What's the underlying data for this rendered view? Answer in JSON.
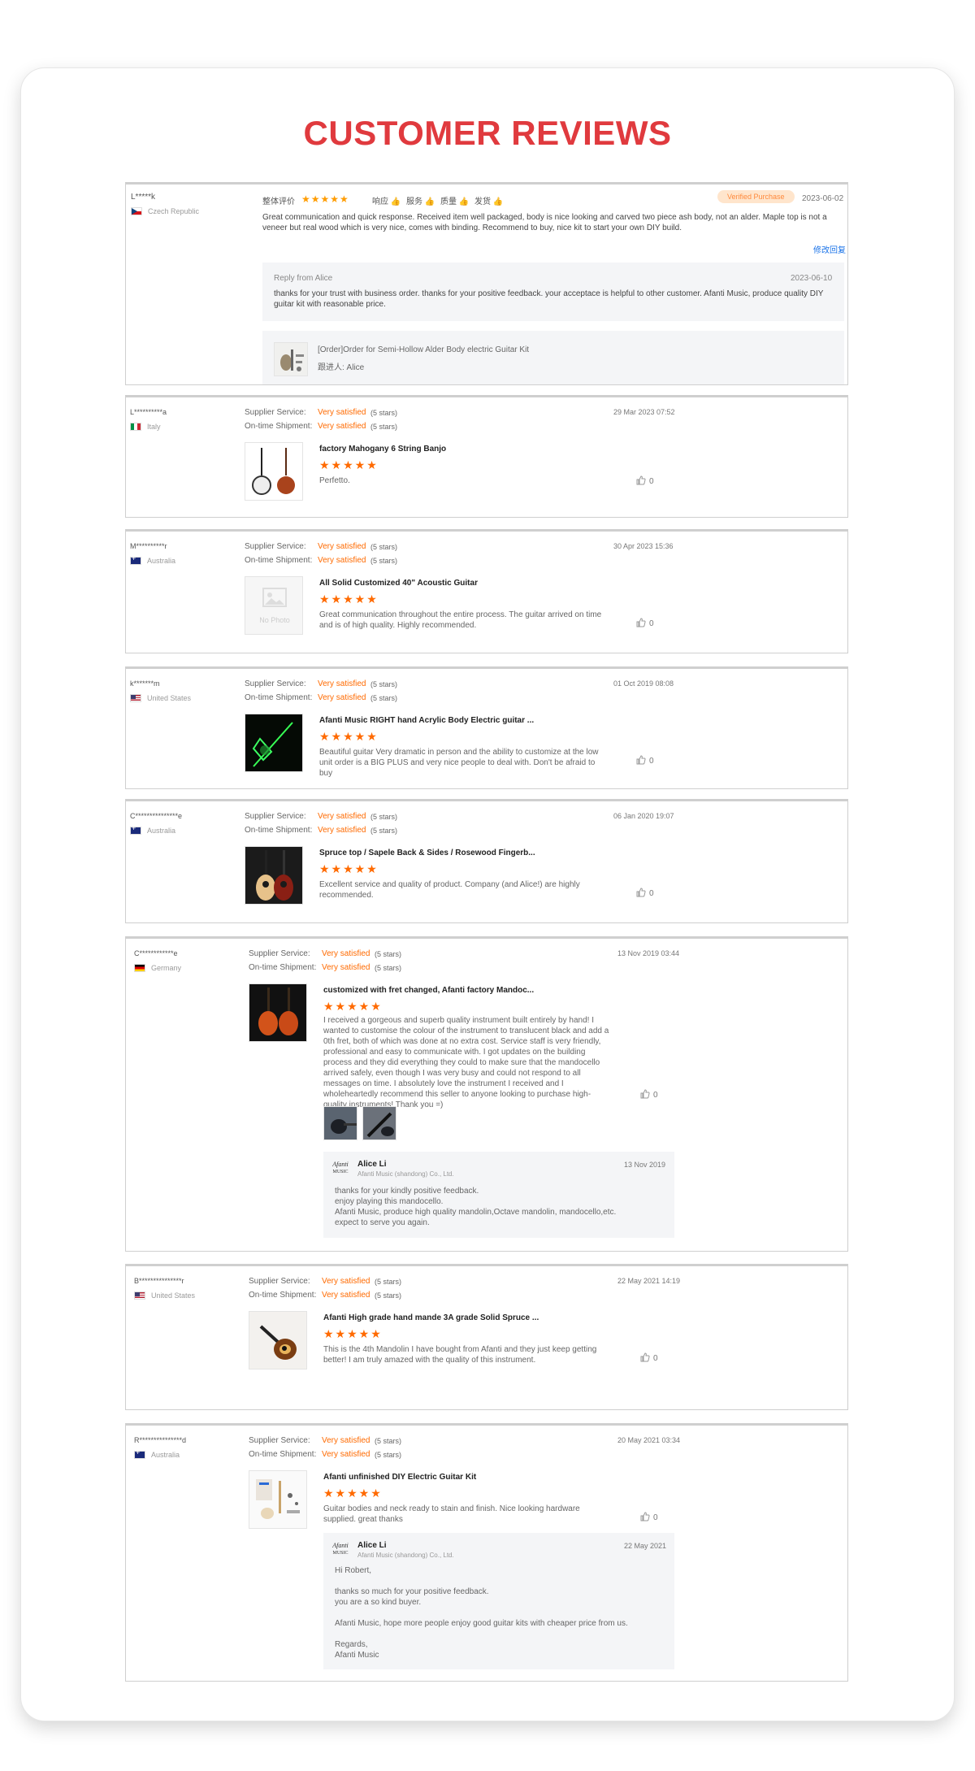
{
  "heading": "CUSTOMER REVIEWS",
  "colors": {
    "accent": "#e03a3e",
    "star": "#ff6a00",
    "satisfied": "#ff6a00"
  },
  "labels": {
    "supplier_service": "Supplier Service:",
    "ontime_shipment": "On-time Shipment:",
    "very_satisfied": "Very satisfied",
    "five_stars": "(5 stars)",
    "no_photo": "No Photo"
  },
  "first_review": {
    "reviewer": "L*****k",
    "country": "Czech Republic",
    "overall_label": "整体评价",
    "stars": 5,
    "tags": [
      "响应",
      "服务",
      "质量",
      "发货"
    ],
    "verified": "Verified Purchase",
    "date": "2023-06-02",
    "text": "Great communication and quick response. Received item well packaged, body is nice looking and carved two piece ash body, not an alder. Maple top is not a veneer but real wood which is very nice, comes with binding. Recommend to buy, nice kit to start your own DIY build.",
    "edit_reply": "修改回复",
    "reply_from": "Reply from Alice",
    "reply_date": "2023-06-10",
    "reply_text": "thanks for your trust with business order. thanks for your positive feedback. your acceptace is helpful to other customer. Afanti Music, produce quality DIY guitar kit with reasonable price.",
    "order_title": "[Order]Order for Semi-Hollow Alder Body electric Guitar Kit",
    "order_follower": "跟进人: Alice"
  },
  "reviews": [
    {
      "reviewer": "L**********a",
      "country": "Italy",
      "flag": "it",
      "date": "29 Mar 2023 07:52",
      "product": "factory Mahogany 6 String Banjo",
      "stars": 5,
      "text": "Perfetto.",
      "likes": "0",
      "thumb": "banjo"
    },
    {
      "reviewer": "M**********r",
      "country": "Australia",
      "flag": "au",
      "date": "30 Apr 2023 15:36",
      "product": "All Solid Customized 40\" Acoustic Guitar",
      "stars": 5,
      "text": "Great communication throughout the entire process. The guitar arrived on time and is of high quality. Highly recommended.",
      "likes": "0",
      "thumb": "nophoto"
    },
    {
      "reviewer": "k*******m",
      "country": "United States",
      "flag": "us",
      "date": "01 Oct 2019 08:08",
      "product": "Afanti Music RIGHT hand Acrylic Body Electric guitar ...",
      "stars": 5,
      "text": "Beautiful guitar   Very dramatic in person and the ability to customize at the low unit order is a BIG PLUS and very nice people to deal with.  Don't be afraid to buy",
      "likes": "0",
      "thumb": "acrylic"
    },
    {
      "reviewer": "C***************e",
      "country": "Australia",
      "flag": "au",
      "date": "06 Jan 2020 19:07",
      "product": "Spruce top / Sapele Back & Sides / Rosewood Fingerb...",
      "stars": 5,
      "text": "Excellent service and quality of product. Company (and Alice!) are highly recommended.",
      "likes": "0",
      "thumb": "pair"
    },
    {
      "reviewer": "C************e",
      "country": "Germany",
      "flag": "de",
      "date": "13 Nov 2019 03:44",
      "product": "customized with fret changed, Afanti factory Mandoc...",
      "stars": 5,
      "text": "I received a gorgeous and superb quality instrument built entirely by hand! I wanted to customise the colour of the instrument to translucent black and add a 0th fret, both of which was done at no extra cost. Service staff is very friendly, professional and easy to communicate with. I got updates on the building process and they did everything they could to make sure that the mandocello arrived safely, even though I was very busy and could not respond to all messages on time. I absolutely love the instrument I received and I wholeheartedly recommend this seller to anyone looking to purchase high-quality instruments! Thank you =)",
      "likes": "0",
      "thumb": "mando2",
      "reply": {
        "name": "Alice Li",
        "company": "Afanti Music (shandong) Co., Ltd.",
        "date": "13 Nov 2019",
        "text": "thanks for your kindly positive feedback.\nenjoy playing this mandocello.\nAfanti Music,  produce high quality mandolin,Octave mandolin, mandocello,etc.\nexpect to serve you again."
      }
    },
    {
      "reviewer": "B***************r",
      "country": "United States",
      "flag": "us",
      "date": "22 May 2021 14:19",
      "product": "Afanti High grade hand mande 3A grade Solid Spruce ...",
      "stars": 5,
      "text": "This is the 4th Mandolin I have bought from Afanti and they just keep getting better! I am truly amazed with the quality of this instrument.",
      "likes": "0",
      "thumb": "mandolin"
    },
    {
      "reviewer": "R***************d",
      "country": "Australia",
      "flag": "au",
      "date": "20 May 2021 03:34",
      "product": "Afanti unfinished DIY Electric Guitar Kit",
      "stars": 5,
      "text": "Guitar bodies and neck ready to stain and finish. Nice looking hardware supplied. great thanks",
      "likes": "0",
      "thumb": "kit",
      "reply": {
        "name": "Alice Li",
        "company": "Afanti Music (shandong) Co., Ltd.",
        "date": "22 May 2021",
        "text": "Hi Robert,\n\nthanks so much for your positive feedback.\nyou are a so kind buyer.\n\nAfanti Music, hope more people enjoy good guitar kits with cheaper price from us.\n\nRegards,\nAfanti Music"
      }
    }
  ]
}
